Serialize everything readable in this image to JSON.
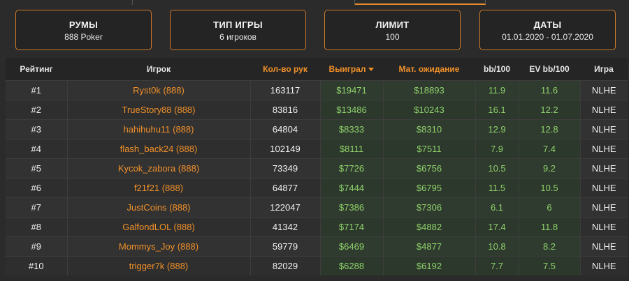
{
  "filters": [
    {
      "title": "РУМЫ",
      "value": "888 Poker"
    },
    {
      "title": "ТИП ИГРЫ",
      "value": "6 игроков"
    },
    {
      "title": "ЛИМИТ",
      "value": "100"
    },
    {
      "title": "ДАТЫ",
      "value": "01.01.2020 - 01.07.2020"
    }
  ],
  "table": {
    "headers": {
      "rank": "Рейтинг",
      "player": "Игрок",
      "hands": "Кол-во рук",
      "won": "Выиграл",
      "ev": "Мат. ожидание",
      "bb100": "bb/100",
      "evbb100": "EV bb/100",
      "game": "Игра"
    },
    "rows": [
      {
        "rank": "#1",
        "player": "Ryst0k (888)",
        "hands": "163117",
        "won": "$19471",
        "ev": "$18893",
        "bb100": "11.9",
        "evbb100": "11.6",
        "game": "NLHE"
      },
      {
        "rank": "#2",
        "player": "TrueStory88 (888)",
        "hands": "83816",
        "won": "$13486",
        "ev": "$10243",
        "bb100": "16.1",
        "evbb100": "12.2",
        "game": "NLHE"
      },
      {
        "rank": "#3",
        "player": "hahihuhu11 (888)",
        "hands": "64804",
        "won": "$8333",
        "ev": "$8310",
        "bb100": "12.9",
        "evbb100": "12.8",
        "game": "NLHE"
      },
      {
        "rank": "#4",
        "player": "flash_back24 (888)",
        "hands": "102149",
        "won": "$8111",
        "ev": "$7511",
        "bb100": "7.9",
        "evbb100": "7.4",
        "game": "NLHE"
      },
      {
        "rank": "#5",
        "player": "Kycok_zabora (888)",
        "hands": "73349",
        "won": "$7726",
        "ev": "$6756",
        "bb100": "10.5",
        "evbb100": "9.2",
        "game": "NLHE"
      },
      {
        "rank": "#6",
        "player": "f21f21 (888)",
        "hands": "64877",
        "won": "$7444",
        "ev": "$6795",
        "bb100": "11.5",
        "evbb100": "10.5",
        "game": "NLHE"
      },
      {
        "rank": "#7",
        "player": "JustCoins (888)",
        "hands": "122047",
        "won": "$7386",
        "ev": "$7306",
        "bb100": "6.1",
        "evbb100": "6",
        "game": "NLHE"
      },
      {
        "rank": "#8",
        "player": "GalfondLOL (888)",
        "hands": "41342",
        "won": "$7174",
        "ev": "$4882",
        "bb100": "17.4",
        "evbb100": "11.8",
        "game": "NLHE"
      },
      {
        "rank": "#9",
        "player": "Mommys_Joy (888)",
        "hands": "59779",
        "won": "$6469",
        "ev": "$4877",
        "bb100": "10.8",
        "evbb100": "8.2",
        "game": "NLHE"
      },
      {
        "rank": "#10",
        "player": "trigger7k (888)",
        "hands": "82029",
        "won": "$6288",
        "ev": "$6192",
        "bb100": "7.7",
        "evbb100": "7.5",
        "game": "NLHE"
      }
    ]
  },
  "colors": {
    "accent": "#f0902a",
    "positive": "#8fd16a"
  }
}
